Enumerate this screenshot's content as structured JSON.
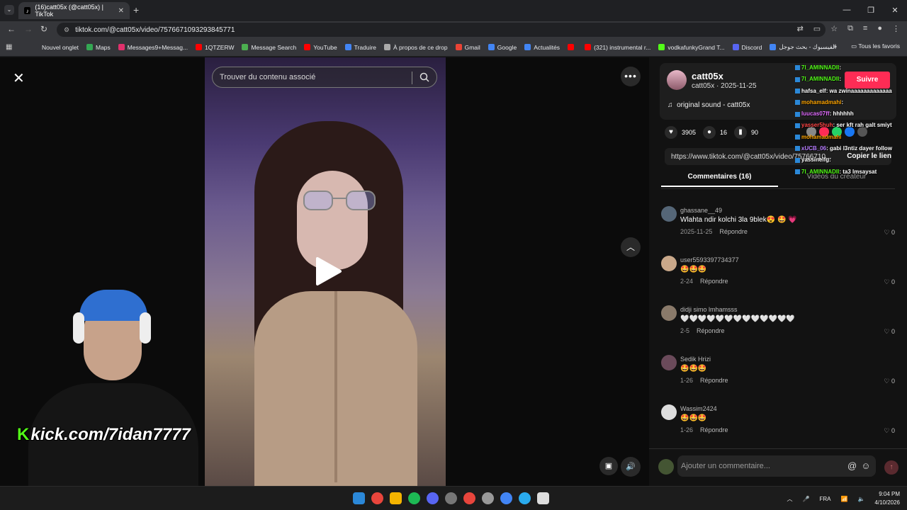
{
  "browser": {
    "tab_title": "(16)catt05x (@catt05x) | TikTok",
    "url": "tiktok.com/@catt05x/video/7576671093293845771",
    "bookmarks": [
      {
        "label": "Nouvel onglet",
        "color": "#35363a"
      },
      {
        "label": "Maps",
        "color": "#34a853"
      },
      {
        "label": "Messages9+Messag...",
        "color": "#e1306c"
      },
      {
        "label": "1QTZERW",
        "color": "#ff0000"
      },
      {
        "label": "Message Search",
        "color": "#4caf50"
      },
      {
        "label": "YouTube",
        "color": "#ff0000"
      },
      {
        "label": "Traduire",
        "color": "#4285f4"
      },
      {
        "label": "À propos de ce drop",
        "color": "#aaaaaa"
      },
      {
        "label": "Gmail",
        "color": "#ea4335"
      },
      {
        "label": "Google",
        "color": "#4285f4"
      },
      {
        "label": "Actualités",
        "color": "#4285f4"
      },
      {
        "label": "",
        "color": "#ff0000"
      },
      {
        "label": "(321) instrumental r...",
        "color": "#ff0000"
      },
      {
        "label": "vodkafunkyGrand T...",
        "color": "#53fc18"
      },
      {
        "label": "Discord",
        "color": "#5865f2"
      },
      {
        "label": "الفيسبوك - بحث جوجل",
        "color": "#4285f4"
      }
    ],
    "all_bookmarks": "Tous les favoris"
  },
  "video": {
    "search_placeholder": "Trouver du contenu associé"
  },
  "stream": {
    "kick_url": "kick.com/7idan7777"
  },
  "post": {
    "author": "catt05x",
    "author_sub": "catt05x · 2025-11-25",
    "sound": "original sound - catt05x",
    "likes": "3905",
    "comments_count": "16",
    "saves": "90",
    "link": "https://www.tiktok.com/@catt05x/video/75766710...",
    "copy_label": "Copier le lien",
    "follow_label": "Suivre",
    "tab_comments": "Commentaires (16)",
    "tab_videos": "Vidéos du créateur"
  },
  "comments": [
    {
      "user": "ghassane__49",
      "text": "Wlahta ndir kolchi 3la 9blek😍 🤩 💗",
      "date": "2025-11-25",
      "reply": "Répondre",
      "likes": "0",
      "avatar_color": "#556677"
    },
    {
      "user": "user5593397734377",
      "text": "🤩🤩🤩",
      "date": "2-24",
      "reply": "Répondre",
      "likes": "0",
      "avatar_color": "#c9a88a"
    },
    {
      "user": "didji simo lmhamsss",
      "text": "🤍🤍🤍🤍🤍🤍🤍🤍🤍🤍🤍🤍🤍",
      "date": "2-5",
      "reply": "Répondre",
      "likes": "0",
      "avatar_color": "#8a7a6a"
    },
    {
      "user": "Sedik Hrizi",
      "text": "🤩🤩🤩",
      "date": "1-26",
      "reply": "Répondre",
      "likes": "0",
      "avatar_color": "#6a4a5a"
    },
    {
      "user": "Wassim2424",
      "text": "🤩🤩🤩",
      "date": "1-26",
      "reply": "Répondre",
      "likes": "0",
      "avatar_color": "#dddddd"
    }
  ],
  "comment_input": {
    "placeholder": "Ajouter un commentaire..."
  },
  "chat": [
    {
      "user": "7I_AMINNADII",
      "msg": ": ",
      "color": "#53fc18"
    },
    {
      "user": "7I_AMINNADII",
      "msg": ": ",
      "color": "#53fc18"
    },
    {
      "user": "hafsa_elf",
      "msg": ": wa zwinaaaaaaaaaaaaa",
      "color": "#ffffff"
    },
    {
      "user": "mohamadmahi",
      "msg": ": ",
      "color": "#ffa500"
    },
    {
      "user": "luucas07ff",
      "msg": ": hhhhhh",
      "color": "#e26cff"
    },
    {
      "user": "yasser5huh",
      "msg": ": ser kft rah galt smiyt",
      "color": "#ff4444"
    },
    {
      "user": "mohamadmahi",
      "msg": "",
      "color": "#ffa500"
    },
    {
      "user": "xUCB_06",
      "msg": ": gabi l3ntiz dayer follow",
      "color": "#b67cff"
    },
    {
      "user": "yassinelfg",
      "msg": ": ",
      "color": "#ffffff"
    },
    {
      "user": "7I_AMINNADII",
      "msg": ": ta3 lmsaysat",
      "color": "#53fc18"
    }
  ],
  "taskbar": {
    "lang": "FRA",
    "time": "9:04 PM",
    "date": "4/10/2026"
  }
}
